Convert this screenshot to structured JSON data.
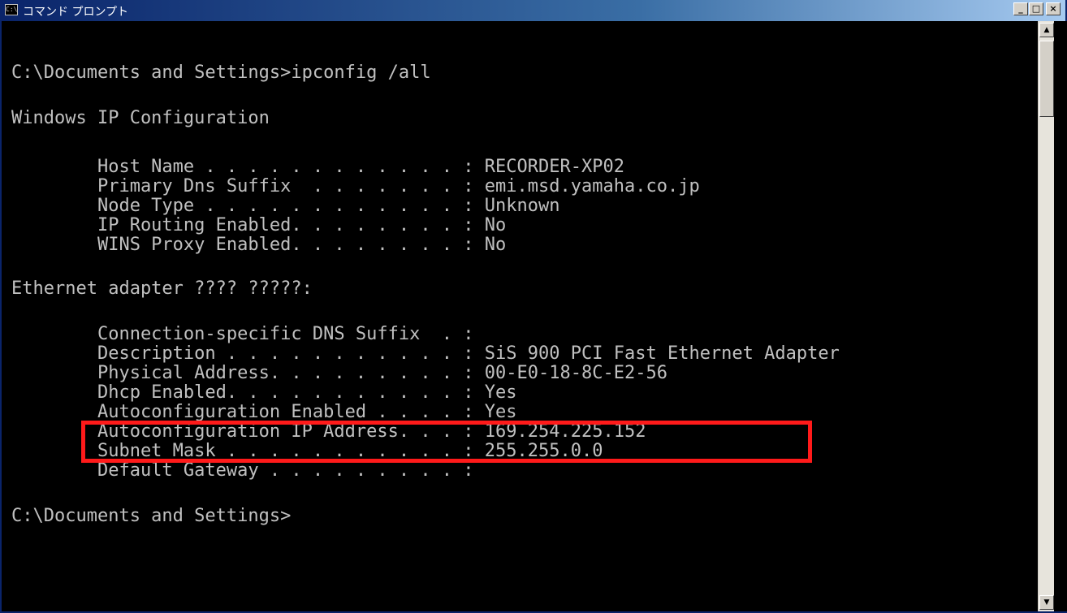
{
  "window": {
    "title": "コマンド プロンプト",
    "icon_label": "C:\\",
    "buttons": {
      "minimize": "_",
      "maximize": "□",
      "close": "×"
    }
  },
  "console": {
    "lines": [
      "",
      "C:\\Documents and Settings>ipconfig /all",
      "",
      "Windows IP Configuration",
      "",
      "        Host Name . . . . . . . . . . . . : RECORDER-XP02",
      "        Primary Dns Suffix  . . . . . . . : emi.msd.yamaha.co.jp",
      "        Node Type . . . . . . . . . . . . : Unknown",
      "        IP Routing Enabled. . . . . . . . : No",
      "        WINS Proxy Enabled. . . . . . . . : No",
      "",
      "Ethernet adapter ???? ?????:",
      "",
      "        Connection-specific DNS Suffix  . :",
      "        Description . . . . . . . . . . . : SiS 900 PCI Fast Ethernet Adapter",
      "        Physical Address. . . . . . . . . : 00-E0-18-8C-E2-56",
      "        Dhcp Enabled. . . . . . . . . . . : Yes",
      "        Autoconfiguration Enabled . . . . : Yes",
      "        Autoconfiguration IP Address. . . : 169.254.225.152",
      "        Subnet Mask . . . . . . . . . . . : 255.255.0.0",
      "        Default Gateway . . . . . . . . . :",
      "",
      "C:\\Documents and Settings>"
    ]
  },
  "annotation": {
    "highlight_color": "#ff1a1a"
  },
  "scrollbar": {
    "up_arrow": "▲",
    "down_arrow": "▼"
  }
}
